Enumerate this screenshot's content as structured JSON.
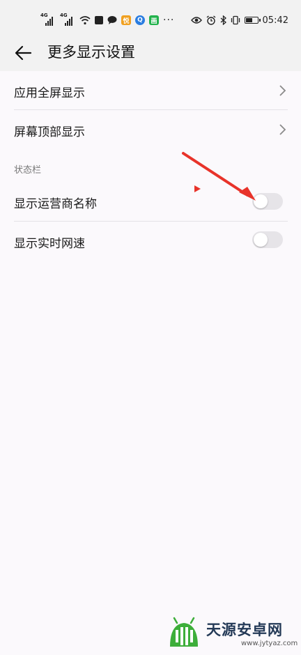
{
  "status_bar": {
    "network_tag_1": "4G",
    "network_tag_2": "4G",
    "app_icon_1_text": "悦",
    "app_icon_2_text": "Q",
    "app_icon_3_text": "画",
    "more": "···",
    "time": "05:42",
    "battery_level": 0.6
  },
  "header": {
    "title": "更多显示设置"
  },
  "rows": {
    "fullscreen": "应用全屏显示",
    "top_display": "屏幕顶部显示"
  },
  "section": {
    "status_bar": "状态栏"
  },
  "toggles": {
    "carrier_name": {
      "label": "显示运营商名称",
      "on": false
    },
    "network_speed": {
      "label": "显示实时网速",
      "on": false
    }
  },
  "watermark": {
    "text": "天源安卓网",
    "url": "www.jytyaz.com"
  },
  "colors": {
    "arrow": "#e8332a",
    "toggle_off": "#e6e4e8",
    "background": "#fbf9fc"
  }
}
